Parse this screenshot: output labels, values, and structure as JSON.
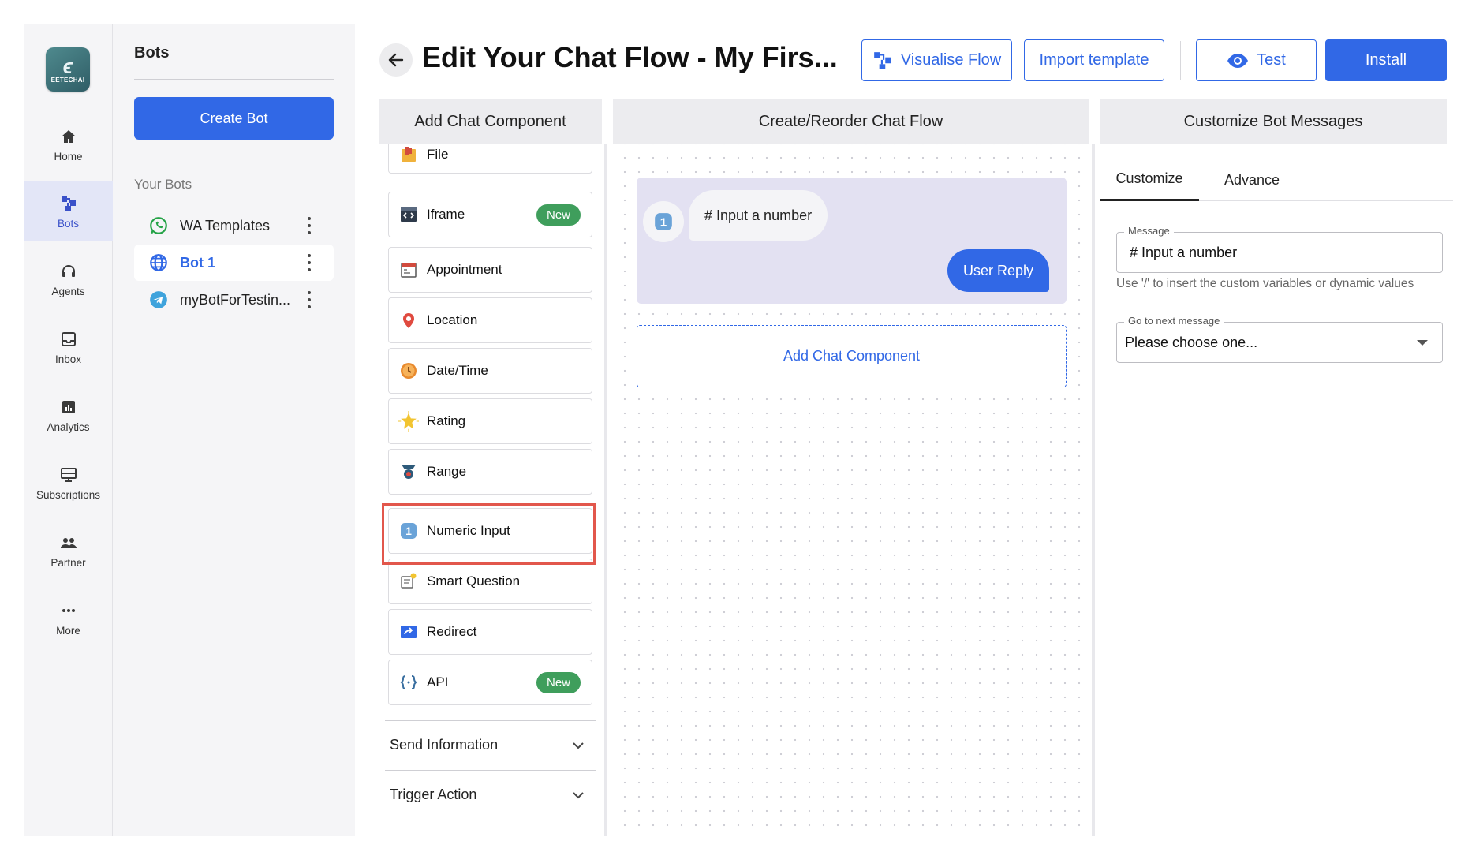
{
  "nav": {
    "logo_text": "EETECHAI",
    "items": [
      {
        "label": "Home",
        "icon": "home-icon"
      },
      {
        "label": "Bots",
        "icon": "bots-icon"
      },
      {
        "label": "Agents",
        "icon": "headset-icon"
      },
      {
        "label": "Inbox",
        "icon": "inbox-icon"
      },
      {
        "label": "Analytics",
        "icon": "analytics-icon"
      },
      {
        "label": "Subscriptions",
        "icon": "subscriptions-icon"
      },
      {
        "label": "Partner",
        "icon": "partner-icon"
      },
      {
        "label": "More",
        "icon": "more-icon"
      }
    ],
    "active": "Bots"
  },
  "bots": {
    "title": "Bots",
    "create_label": "Create Bot",
    "section_label": "Your Bots",
    "items": [
      {
        "label": "WA Templates",
        "icon": "whatsapp-icon"
      },
      {
        "label": "Bot 1",
        "icon": "globe-icon"
      },
      {
        "label": "myBotForTestin...",
        "icon": "telegram-icon"
      }
    ],
    "active": "Bot 1"
  },
  "header": {
    "title": "Edit Your Chat Flow - My Firs...",
    "visualise_label": "Visualise Flow",
    "import_label": "Import template",
    "test_label": "Test",
    "install_label": "Install"
  },
  "panels": {
    "components_title": "Add Chat Component",
    "flow_title": "Create/Reorder Chat Flow",
    "customize_title": "Customize Bot Messages"
  },
  "components": [
    {
      "label": "File",
      "icon": "file-icon"
    },
    {
      "label": "Iframe",
      "icon": "iframe-icon",
      "badge": "New"
    },
    {
      "label": "Appointment",
      "icon": "appointment-icon"
    },
    {
      "label": "Location",
      "icon": "location-pin-icon"
    },
    {
      "label": "Date/Time",
      "icon": "clock-icon"
    },
    {
      "label": "Rating",
      "icon": "rating-star-icon"
    },
    {
      "label": "Range",
      "icon": "range-icon"
    },
    {
      "label": "Numeric Input",
      "icon": "numeric-input-icon"
    },
    {
      "label": "Smart Question",
      "icon": "smart-question-icon"
    },
    {
      "label": "Redirect",
      "icon": "redirect-icon"
    },
    {
      "label": "API",
      "icon": "api-icon",
      "badge": "New"
    }
  ],
  "sections": [
    {
      "label": "Send Information"
    },
    {
      "label": "Trigger Action"
    }
  ],
  "flow": {
    "bubble_text": "# Input a number",
    "user_reply_label": "User Reply",
    "add_component_label": "Add Chat Component"
  },
  "customize": {
    "tabs": [
      "Customize",
      "Advance"
    ],
    "active_tab": "Customize",
    "message_label": "Message",
    "message_value": "# Input a number",
    "helper_text": "Use '/' to insert the custom variables or dynamic values",
    "next_label": "Go to next message",
    "next_value": "Please choose one..."
  },
  "colors": {
    "primary": "#3168e6",
    "badge_green": "#3f9e5c",
    "highlight_red": "#e2574c",
    "flow_card": "#e3e1f2"
  }
}
